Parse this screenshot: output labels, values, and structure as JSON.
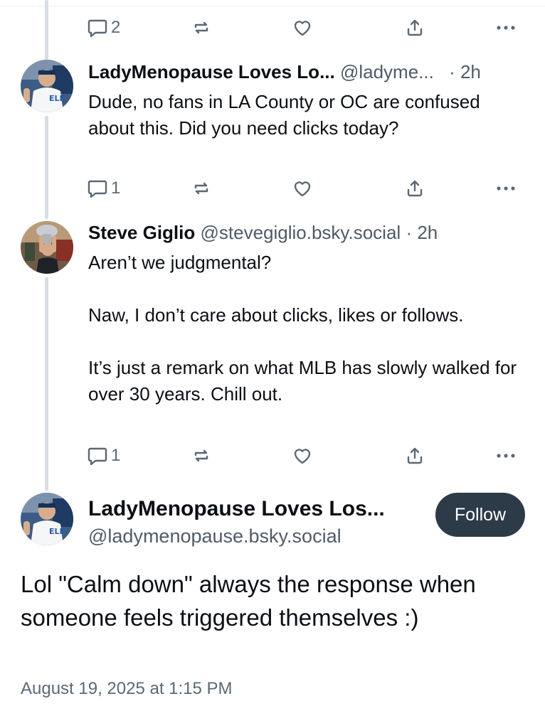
{
  "replies": [
    {
      "actions": {
        "reply_count": "2",
        "repost_count": "",
        "like_count": ""
      }
    },
    {
      "name": "LadyMenopause Loves Lo...",
      "handle": "@ladyme...",
      "time": "· 2h",
      "text": "Dude, no fans in LA County or OC are confused about this. Did you need clicks today?",
      "actions": {
        "reply_count": "1"
      }
    },
    {
      "name": "Steve Giglio",
      "handle": "@stevegiglio.bsky.social",
      "time": "· 2h",
      "text": "Aren’t we judgmental?\n\nNaw, I don’t care about clicks, likes or follows.\n\nIt’s just a remark on what MLB has slowly walked for over 30 years. Chill out.",
      "actions": {
        "reply_count": "1"
      }
    }
  ],
  "main_post": {
    "name": "LadyMenopause Loves Los...",
    "handle": "@ladymenopause.bsky.social",
    "follow_label": "Follow",
    "text": "Lol \"Calm down\" always the response when someone feels triggered themselves :)",
    "timestamp": "August 19, 2025 at 1:15 PM"
  },
  "icons": {
    "reply": "reply-icon",
    "repost": "repost-icon",
    "like": "heart-icon",
    "share": "share-icon",
    "more": "more-options-icon"
  },
  "colors": {
    "text": "#0b0f14",
    "muted": "#4f5b67",
    "thread_line": "#d9dee4",
    "follow_bg": "#2d3a48"
  }
}
